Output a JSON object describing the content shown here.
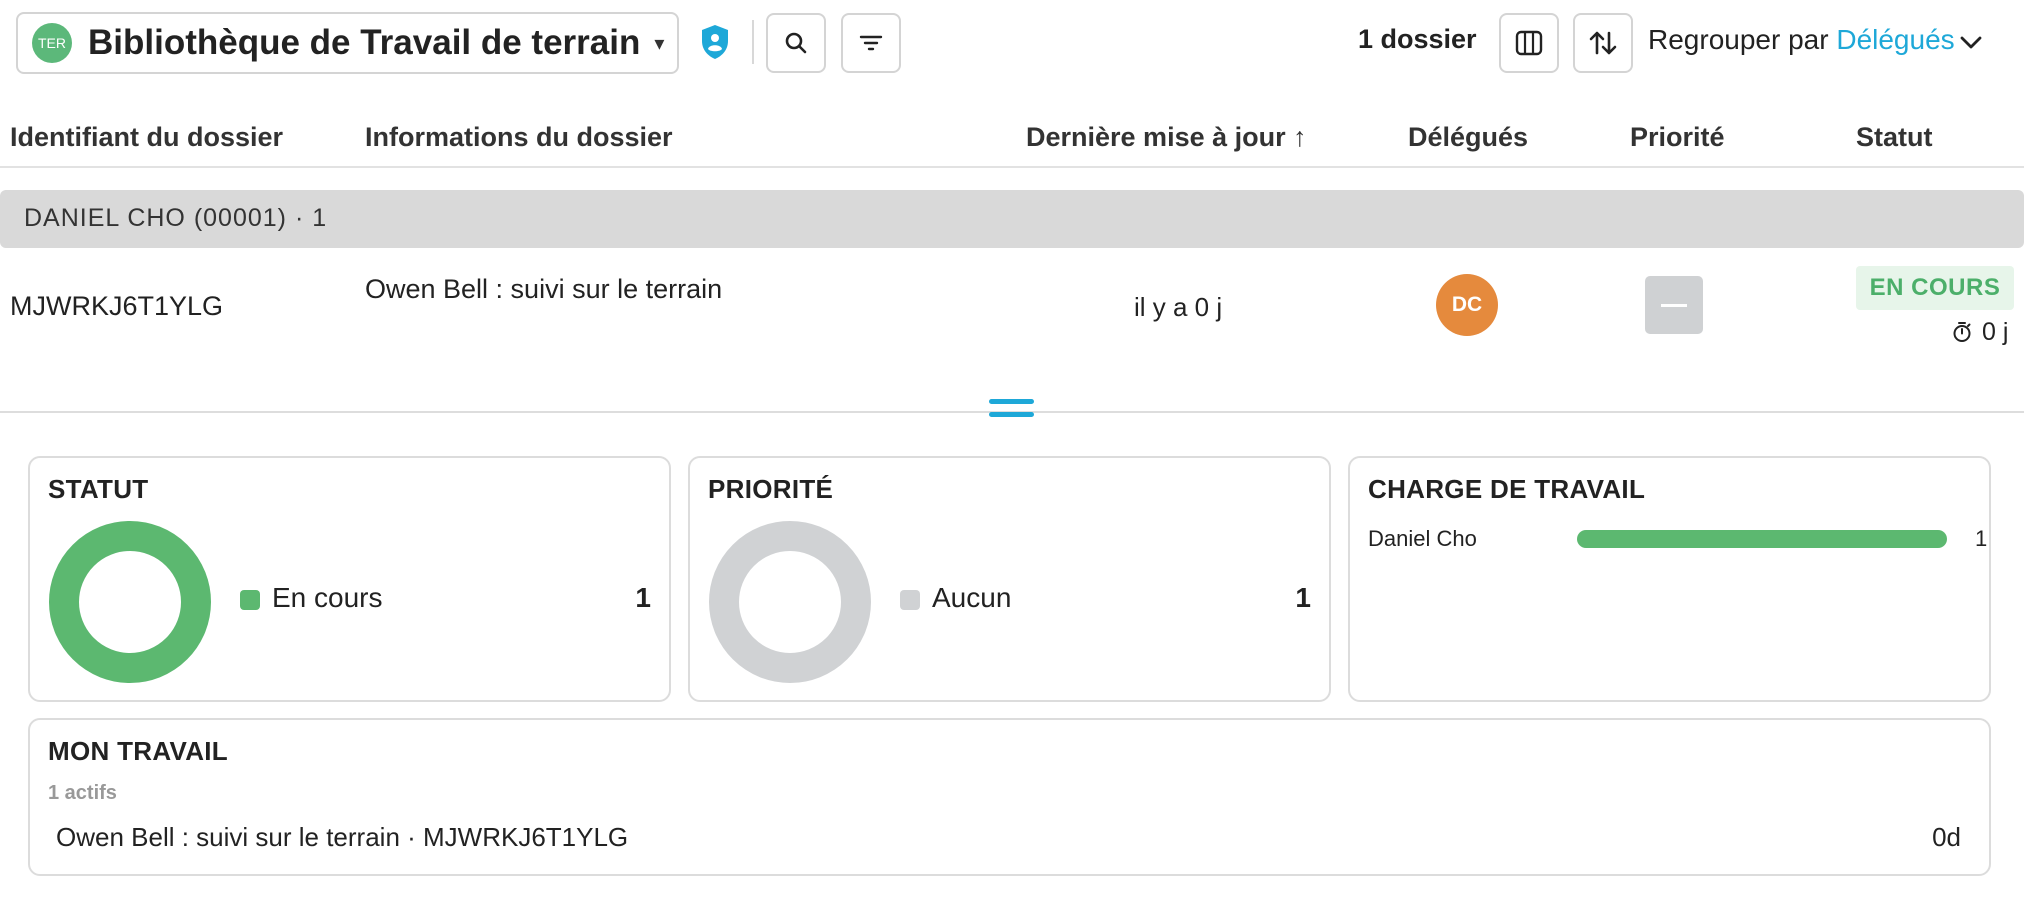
{
  "toolbar": {
    "badge": "TER",
    "library_title": "Bibliothèque de Travail de terrain",
    "caret": "▾",
    "count_label": "1 dossier",
    "group_by_prefix": "Regrouper par ",
    "group_by_value": "Délégués"
  },
  "icons": {
    "shield": "shield-icon",
    "search": "search-icon",
    "filter": "filter-icon",
    "columns": "columns-icon",
    "sort": "sort-icon",
    "chevron": "chevron-down-icon",
    "timer": "stopwatch-icon"
  },
  "table": {
    "headers": {
      "id": "Identifiant du dossier",
      "info": "Informations du dossier",
      "updated": "Dernière mise à jour ↑",
      "delegates": "Délégués",
      "priority": "Priorité",
      "status": "Statut"
    },
    "group": {
      "label": "DANIEL CHO (00001)  ·  1"
    },
    "rows": [
      {
        "id": "MJWRKJ6T1YLG",
        "info": "Owen Bell : suivi sur le terrain",
        "updated": "il y a 0 j",
        "delegate_initials": "DC",
        "status": "EN COURS",
        "timer": "0 j"
      }
    ]
  },
  "cards": {
    "status": {
      "title": "STATUT",
      "legend_label": "En cours",
      "legend_value": "1",
      "color": "#5cb870"
    },
    "priority": {
      "title": "PRIORITÉ",
      "legend_label": "Aucun",
      "legend_value": "1",
      "color": "#d0d2d4"
    },
    "workload": {
      "title": "CHARGE DE TRAVAIL",
      "name": "Daniel Cho",
      "value": "1"
    },
    "my_work": {
      "title": "MON TRAVAIL",
      "subtitle": "1 actifs",
      "item": "Owen Bell : suivi sur le terrain · MJWRKJ6T1YLG",
      "age": "0d"
    }
  },
  "colors": {
    "accent": "#1ea8d8",
    "green": "#5cb870",
    "avatar": "#e58a3d",
    "status_bg": "#e7f5ea",
    "group_bg": "#d9d9d9"
  }
}
